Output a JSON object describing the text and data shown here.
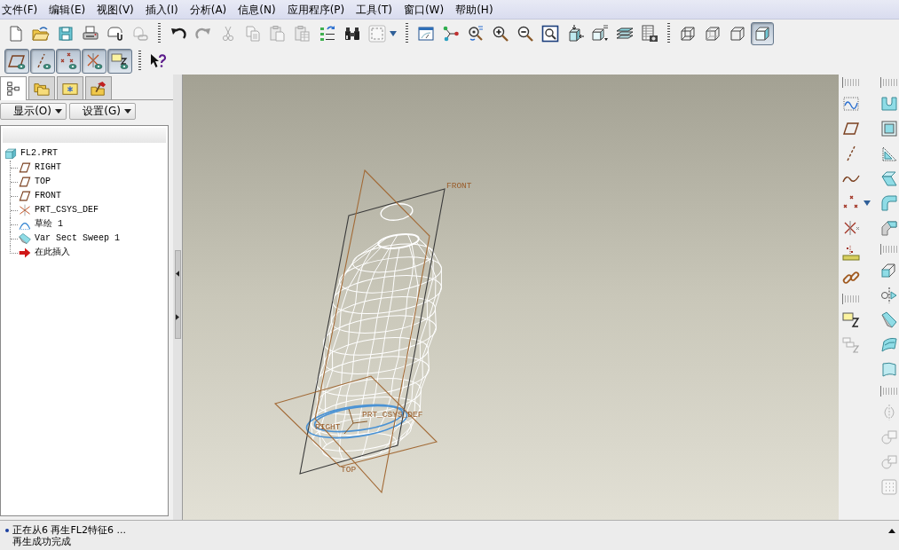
{
  "menu_bar": [
    "文件(F)",
    "编辑(E)",
    "视图(V)",
    "插入(I)",
    "分析(A)",
    "信息(N)",
    "应用程序(P)",
    "工具(T)",
    "窗口(W)",
    "帮助(H)"
  ],
  "main_toolbar": [
    [
      {
        "kind": "new",
        "disabled": false
      },
      {
        "kind": "open",
        "disabled": false
      },
      {
        "kind": "save",
        "disabled": false
      },
      {
        "kind": "print",
        "disabled": false
      },
      {
        "kind": "send",
        "disabled": false
      },
      {
        "kind": "send-link",
        "disabled": true
      }
    ],
    [
      {
        "kind": "undo",
        "disabled": false
      },
      {
        "kind": "redo",
        "disabled": true
      },
      {
        "kind": "cut",
        "disabled": true
      },
      {
        "kind": "copy",
        "disabled": true
      },
      {
        "kind": "paste",
        "disabled": true
      },
      {
        "kind": "paste-special",
        "disabled": true
      },
      {
        "kind": "regenerate",
        "disabled": false
      },
      {
        "kind": "find",
        "disabled": false
      },
      {
        "kind": "select-box",
        "disabled": false
      }
    ],
    [
      {
        "kind": "repaint",
        "disabled": false
      },
      {
        "kind": "spin-center",
        "disabled": false
      },
      {
        "kind": "orient",
        "disabled": false
      },
      {
        "kind": "zoom-in",
        "disabled": false
      },
      {
        "kind": "zoom-out",
        "disabled": false
      },
      {
        "kind": "refit",
        "disabled": false
      },
      {
        "kind": "reorient",
        "disabled": false
      },
      {
        "kind": "saved-views",
        "disabled": false
      },
      {
        "kind": "layers",
        "disabled": false
      },
      {
        "kind": "view-manager",
        "disabled": false
      }
    ],
    [
      {
        "kind": "wireframe",
        "selected": false
      },
      {
        "kind": "hidden-line",
        "selected": false
      },
      {
        "kind": "no-hidden",
        "selected": false
      },
      {
        "kind": "shaded",
        "selected": true
      }
    ]
  ],
  "display_toolbar": [
    [
      {
        "kind": "plane-display",
        "on": true
      },
      {
        "kind": "axis-display",
        "on": true
      },
      {
        "kind": "point-display",
        "on": true
      },
      {
        "kind": "csys-display",
        "on": true
      },
      {
        "kind": "annotation-display",
        "on": true
      }
    ],
    [
      {
        "kind": "whats-this",
        "disabled": false
      }
    ]
  ],
  "navigator": {
    "tabs": [
      {
        "kind": "model-tree",
        "selected": true
      },
      {
        "kind": "folder-browser",
        "selected": false
      },
      {
        "kind": "favorites",
        "selected": false
      },
      {
        "kind": "connections",
        "selected": false
      }
    ],
    "menus": [
      "显示(O)",
      "设置(G)"
    ],
    "tree": [
      {
        "label": "FL2.PRT",
        "kind": "part",
        "children": [
          {
            "label": "RIGHT",
            "kind": "plane"
          },
          {
            "label": "TOP",
            "kind": "plane"
          },
          {
            "label": "FRONT",
            "kind": "plane"
          },
          {
            "label": "PRT_CSYS_DEF",
            "kind": "csys"
          },
          {
            "label": "草绘 1",
            "kind": "sketch"
          },
          {
            "label": "Var Sect Sweep 1",
            "kind": "sweep"
          },
          {
            "label": "在此插入",
            "kind": "insert"
          }
        ]
      }
    ]
  },
  "graphics": {
    "datum_planes": [
      {
        "label": "FRONT",
        "color": "#3a3a3a"
      },
      {
        "label": "RIGHT",
        "color": "#a26a36"
      },
      {
        "label": "TOP",
        "color": "#a26a36"
      }
    ],
    "csys_label": "PRT_CSYS_DEF"
  },
  "datum_tools": [
    [
      {
        "kind": "sketch",
        "disabled": false
      },
      {
        "kind": "plane",
        "disabled": false
      },
      {
        "kind": "axis",
        "disabled": false
      },
      {
        "kind": "curve",
        "disabled": false
      },
      {
        "kind": "point",
        "disabled": false
      },
      {
        "kind": "csys",
        "disabled": false
      },
      {
        "kind": "analysis",
        "disabled": false
      },
      {
        "kind": "chain",
        "disabled": false
      }
    ],
    [
      {
        "kind": "annotation",
        "disabled": false
      },
      {
        "kind": "annotation-element",
        "disabled": true
      }
    ]
  ],
  "feature_tools": [
    [
      {
        "kind": "hole",
        "disabled": false
      },
      {
        "kind": "shell",
        "disabled": false
      },
      {
        "kind": "rib",
        "disabled": false
      },
      {
        "kind": "draft",
        "disabled": false
      },
      {
        "kind": "round",
        "disabled": false
      },
      {
        "kind": "chamfer",
        "disabled": false
      }
    ],
    [
      {
        "kind": "extrude",
        "disabled": false
      },
      {
        "kind": "revolve",
        "disabled": false
      },
      {
        "kind": "sweep",
        "disabled": false
      },
      {
        "kind": "blend",
        "disabled": false
      },
      {
        "kind": "style",
        "disabled": false
      }
    ],
    [
      {
        "kind": "mirror",
        "disabled": true
      },
      {
        "kind": "merge",
        "disabled": true
      },
      {
        "kind": "trim",
        "disabled": true
      },
      {
        "kind": "pattern",
        "disabled": true
      }
    ]
  ],
  "status_bar": {
    "messages": [
      {
        "text": "正在从6 再生FL2特征6 ...",
        "bullet": true
      },
      {
        "text": "再生成功完成",
        "bullet": false
      }
    ]
  }
}
